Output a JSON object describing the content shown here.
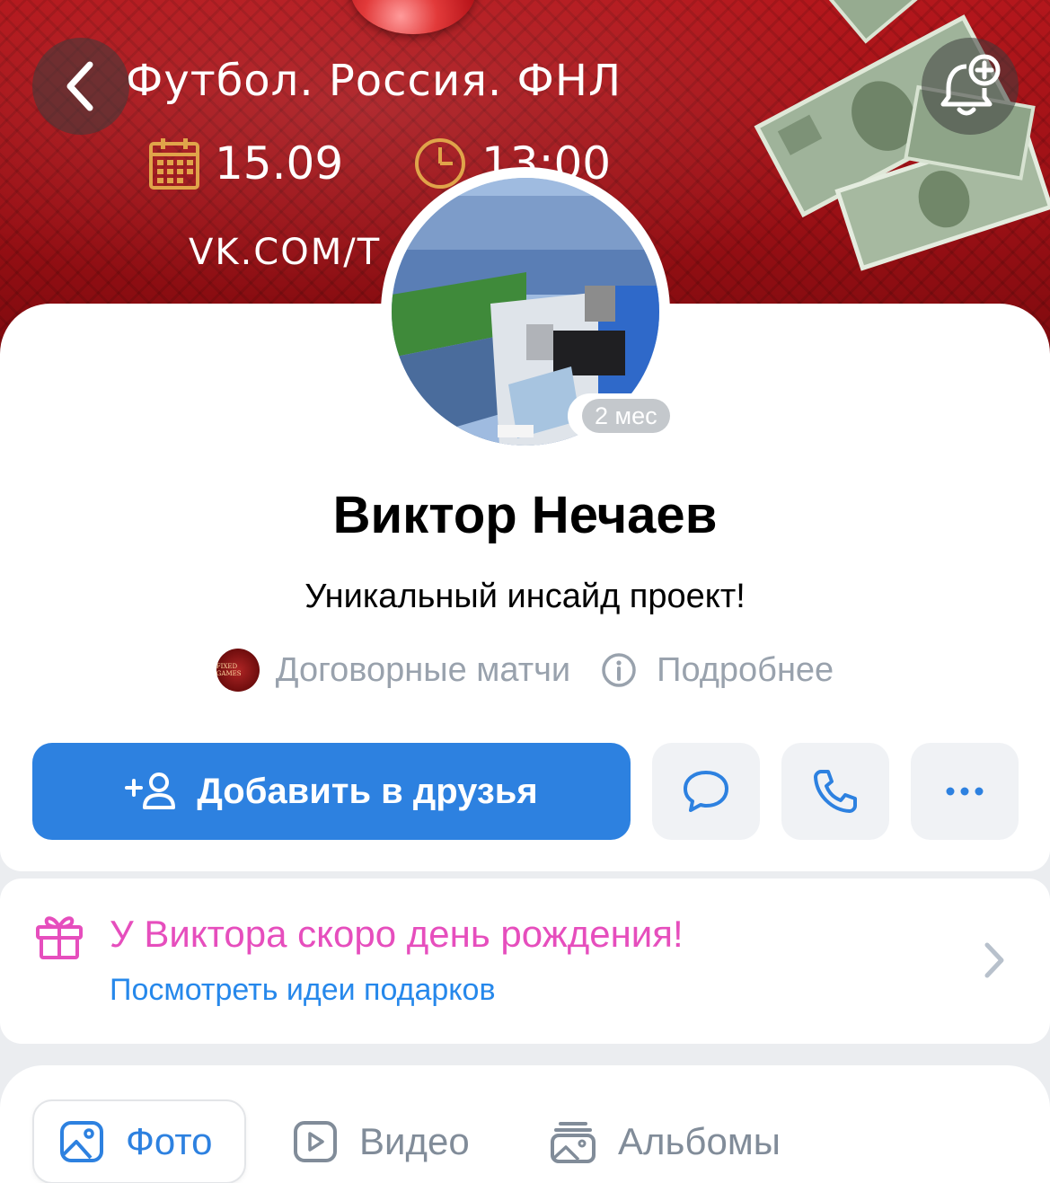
{
  "cover": {
    "title": "Футбол. Россия. ФНЛ",
    "date": "15.09",
    "time": "13:00",
    "url": "VK.COM/T",
    "background_color": "#a31217"
  },
  "nav": {
    "back_icon": "chevron-left-icon",
    "subscribe_icon": "bell-plus-icon"
  },
  "profile": {
    "name": "Виктор Нечаев",
    "status": "Уникальный инсайд проект!",
    "online_badge": "2 мес",
    "group_logo_text": "FIXED GAMES",
    "group_label": "Договорные матчи",
    "details_label": "Подробнее"
  },
  "actions": {
    "add_friend_label": "Добавить в друзья",
    "message_icon": "message-bubble-icon",
    "call_icon": "phone-icon",
    "more_icon": "more-dots-icon",
    "primary_color": "#2d81e0"
  },
  "birthday": {
    "title": "У Виктора скоро день рождения!",
    "subtitle": "Посмотреть идеи подарков",
    "title_color": "#e64ebd",
    "link_color": "#2688eb"
  },
  "media_tabs": {
    "photo_label": "Фото",
    "video_label": "Видео",
    "albums_label": "Альбомы",
    "active": "Фото"
  }
}
